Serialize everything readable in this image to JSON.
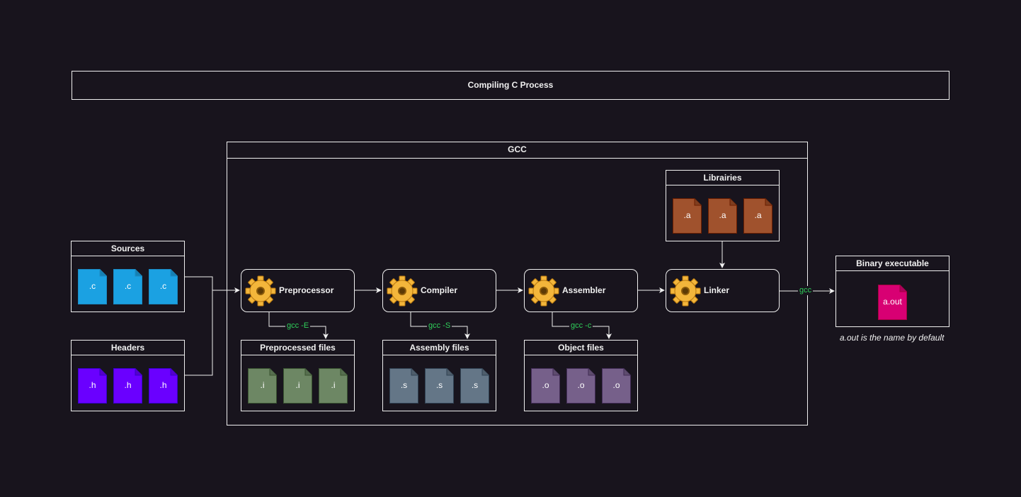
{
  "diagram_title": "Compiling C Process",
  "gcc_group": {
    "title": "GCC"
  },
  "sources": {
    "title": "Sources",
    "files": [
      ".c",
      ".c",
      ".c"
    ],
    "color": "#1ba1e2"
  },
  "headers": {
    "title": "Headers",
    "files": [
      ".h",
      ".h",
      ".h"
    ],
    "color": "#6a00ff"
  },
  "libraries": {
    "title": "Librairies",
    "files": [
      ".a",
      ".a",
      ".a"
    ],
    "color": "#a0522d"
  },
  "stages": {
    "preprocessor": {
      "label": "Preprocessor"
    },
    "compiler": {
      "label": "Compiler"
    },
    "assembler": {
      "label": "Assembler"
    },
    "linker": {
      "label": "Linker"
    }
  },
  "outputs": {
    "preprocessed": {
      "title": "Preprocessed files",
      "command": "gcc -E",
      "files": [
        ".i",
        ".i",
        ".i"
      ],
      "color": "#6d8764"
    },
    "assembly": {
      "title": "Assembly files",
      "command": "gcc -S",
      "files": [
        ".s",
        ".s",
        ".s"
      ],
      "color": "#647687"
    },
    "object": {
      "title": "Object files",
      "command": "gcc -c",
      "files": [
        ".o",
        ".o",
        ".o"
      ],
      "color": "#76608a"
    }
  },
  "binary": {
    "title": "Binary executable",
    "file": "a.out",
    "color": "#d80073",
    "edge_label": "gcc",
    "note": "a.out is the name by default"
  },
  "colors": {
    "background": "#18141d",
    "stroke": "#f0f0f0",
    "command_text": "#2fd05a",
    "gear": "#f0a81e"
  }
}
